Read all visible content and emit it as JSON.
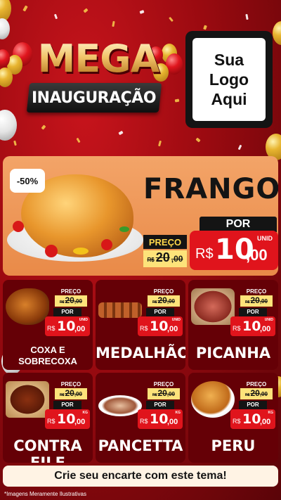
{
  "header": {
    "headline": "MEGA",
    "subheadline": "INAUGURAÇÃO",
    "logo_placeholder_line1": "Sua Logo",
    "logo_placeholder_line2": "Aqui"
  },
  "featured": {
    "discount_badge": "-50%",
    "name": "FRANGO",
    "price_label": "PREÇO",
    "old_price": {
      "currency": "R$",
      "integer": "20",
      "decimal": ",00"
    },
    "promo_label": "POR",
    "new_price": {
      "currency": "R$",
      "integer": "10",
      "decimal": ",00",
      "unit": "UNID"
    },
    "image_icon": "roast-chicken"
  },
  "products": [
    {
      "name": "COXA E SOBRECOXA",
      "price_label": "PREÇO",
      "old_price": {
        "currency": "R$",
        "integer": "20",
        "decimal": ",00"
      },
      "promo_label": "POR",
      "new_price": {
        "currency": "R$",
        "integer": "10",
        "decimal": ",00",
        "unit": "UNID"
      },
      "image_icon": "chicken-leg"
    },
    {
      "name": "MEDALHÃO",
      "price_label": "PREÇO",
      "old_price": {
        "currency": "R$",
        "integer": "20",
        "decimal": ",00"
      },
      "promo_label": "POR",
      "new_price": {
        "currency": "R$",
        "integer": "10",
        "decimal": ",00",
        "unit": "UNID"
      },
      "image_icon": "skewers"
    },
    {
      "name": "PICANHA",
      "price_label": "PREÇO",
      "old_price": {
        "currency": "R$",
        "integer": "20",
        "decimal": ",00"
      },
      "promo_label": "POR",
      "new_price": {
        "currency": "R$",
        "integer": "10",
        "decimal": ",00",
        "unit": "UNID"
      },
      "image_icon": "steak-board"
    },
    {
      "name": "CONTRA FILE",
      "price_label": "PREÇO",
      "old_price": {
        "currency": "R$",
        "integer": "20",
        "decimal": ",00"
      },
      "promo_label": "POR",
      "new_price": {
        "currency": "R$",
        "integer": "10",
        "decimal": ",00",
        "unit": "KG"
      },
      "image_icon": "beef-board"
    },
    {
      "name": "PANCETTA",
      "price_label": "PREÇO",
      "old_price": {
        "currency": "R$",
        "integer": "20",
        "decimal": ",00"
      },
      "promo_label": "POR",
      "new_price": {
        "currency": "R$",
        "integer": "10",
        "decimal": ",00",
        "unit": "KG"
      },
      "image_icon": "pork-roast"
    },
    {
      "name": "PERU",
      "price_label": "PREÇO",
      "old_price": {
        "currency": "R$",
        "integer": "20",
        "decimal": ",00"
      },
      "promo_label": "POR",
      "new_price": {
        "currency": "R$",
        "integer": "10",
        "decimal": ",00",
        "unit": "KG"
      },
      "image_icon": "roast-turkey"
    }
  ],
  "cta": "Crie seu encarte com este tema!",
  "disclaimer": "*Imagens Meramente Ilustrativas",
  "colors": {
    "background": "#9a0a10",
    "accent_red": "#e0141c",
    "card_bg": "#650006",
    "hero_bg": "#e98a48",
    "price_yellow": "#fde37a"
  }
}
